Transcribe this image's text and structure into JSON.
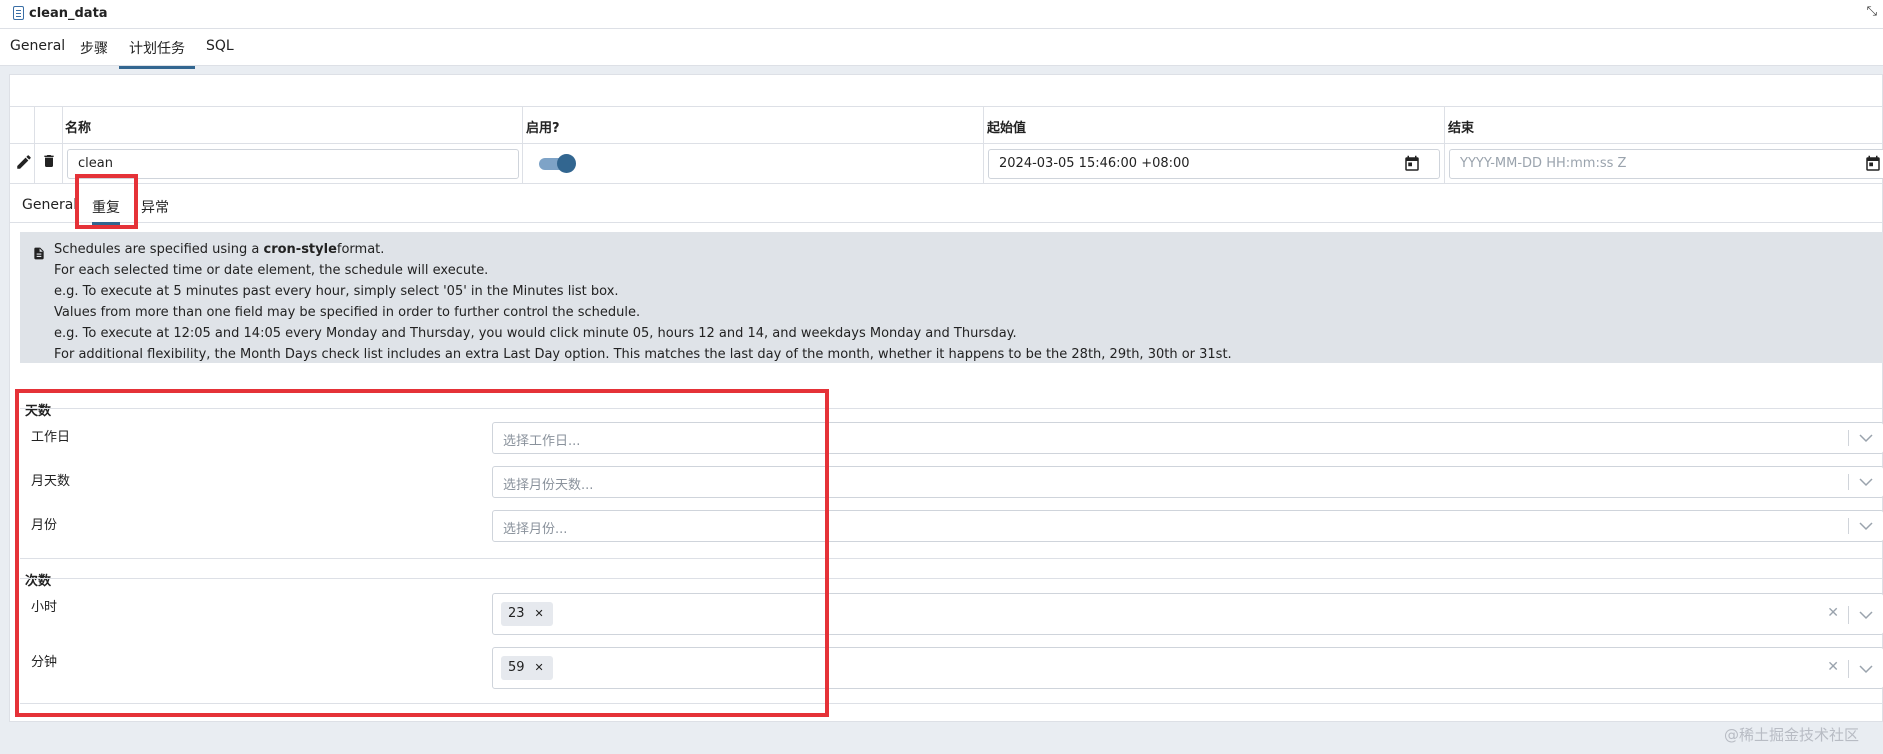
{
  "window": {
    "title": "clean_data",
    "expand_icon": "expand-arrows-icon"
  },
  "main_tabs": [
    {
      "label": "General",
      "active": false
    },
    {
      "label": "步骤",
      "active": false
    },
    {
      "label": "计划任务",
      "active": true
    },
    {
      "label": "SQL",
      "active": false
    }
  ],
  "grid": {
    "headers": {
      "name": "名称",
      "enabled": "启用?",
      "start": "起始值",
      "end": "结束"
    },
    "row": {
      "name": "clean",
      "enabled": true,
      "start": "2024-03-05 15:46:00 +08:00",
      "end_placeholder": "YYYY-MM-DD HH:mm:ss Z"
    }
  },
  "sub_tabs": [
    {
      "label": "General",
      "active": false
    },
    {
      "label": "重复",
      "active": true
    },
    {
      "label": "异常",
      "active": false
    }
  ],
  "info": {
    "line1_pre": "Schedules are specified using a ",
    "line1_bold": "cron-style",
    "line1_post": "format.",
    "line2": "For each selected time or date element, the schedule will execute.",
    "line3": "e.g. To execute at 5 minutes past every hour, simply select '05' in the Minutes list box.",
    "line4": "Values from more than one field may be specified in order to further control the schedule.",
    "line5": "e.g. To execute at 12:05 and 14:05 every Monday and Thursday, you would click minute 05, hours 12 and 14, and weekdays Monday and Thursday.",
    "line6": "For additional flexibility, the Month Days check list includes an extra Last Day option. This matches the last day of the month, whether it happens to be the 28th, 29th, 30th or 31st."
  },
  "days": {
    "heading": "天数",
    "weekdays": {
      "label": "工作日",
      "placeholder": "选择工作日..."
    },
    "monthdays": {
      "label": "月天数",
      "placeholder": "选择月份天数..."
    },
    "months": {
      "label": "月份",
      "placeholder": "选择月份..."
    }
  },
  "times": {
    "heading": "次数",
    "hours": {
      "label": "小时",
      "value": "23"
    },
    "minutes": {
      "label": "分钟",
      "value": "59"
    }
  },
  "watermark": "@稀土掘金技术社区",
  "colors": {
    "accent": "#326690",
    "highlight": "#e53238",
    "info_bg": "#dfe3e8"
  }
}
